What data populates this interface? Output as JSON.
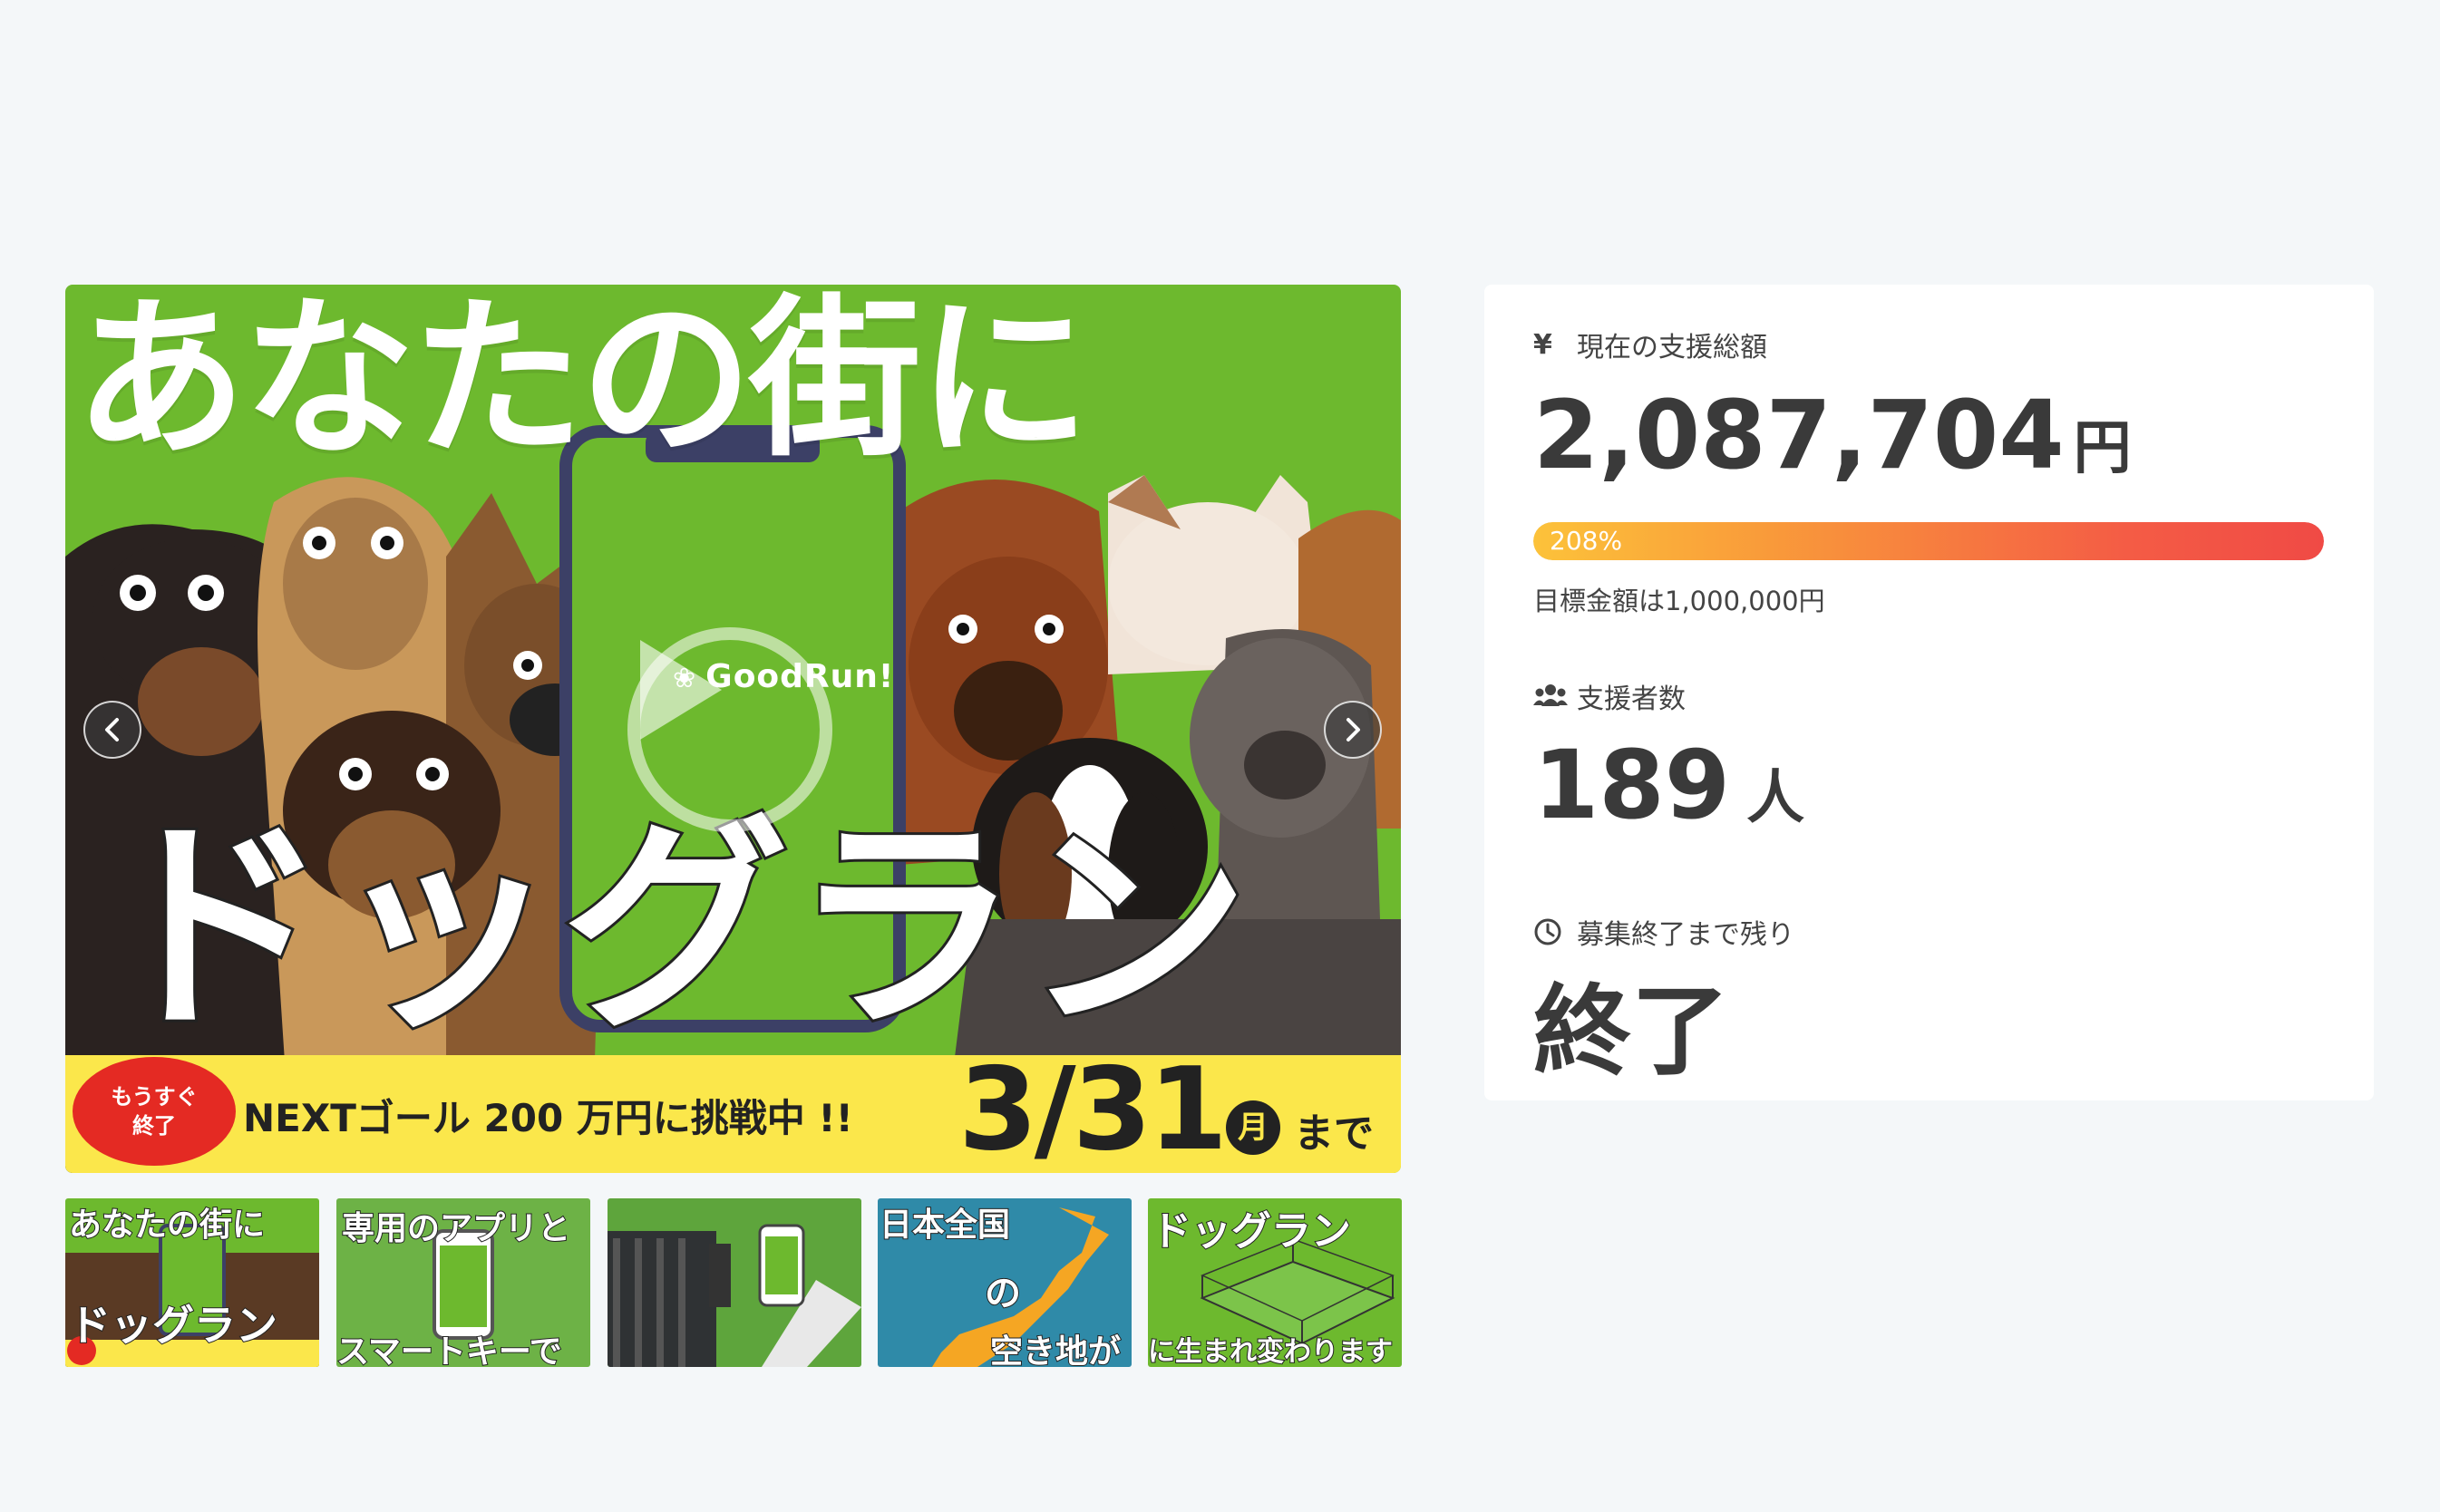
{
  "hero": {
    "title": "あなたの街に",
    "big_text": "ドッグラン",
    "phone_logo": "GoodRun!",
    "badge_line1": "もうすぐ",
    "badge_line2": "終了",
    "banner_text": "NEXTゴール 200 万円に挑戦中 !!",
    "banner_date": "3/31",
    "banner_day": "月",
    "banner_suffix": "まで"
  },
  "thumbnails": [
    {
      "label_top": "あなたの街に",
      "label_bottom": "ドッグラン",
      "color": "#6db92e"
    },
    {
      "label_top": "専用のアプリと",
      "label_bottom": "スマートキーで",
      "color": "#6db246"
    },
    {
      "label_top": "",
      "label_bottom": "",
      "color": "#5ea53c"
    },
    {
      "label_top": "日本全国",
      "label_mid": "の",
      "label_bottom": "空き地が",
      "color": "#2f8aa8"
    },
    {
      "label_top": "ドッグラン",
      "label_bottom": "に生まれ変わります",
      "color": "#6db92e"
    }
  ],
  "stats": {
    "total_label": "現在の支援総額",
    "total_value": "2,087,704",
    "total_unit": "円",
    "progress_text": "208%",
    "progress_percent": 208,
    "goal_text": "目標金額は1,000,000円",
    "supporters_label": "支援者数",
    "supporters_value": "189",
    "supporters_unit": "人",
    "remaining_label": "募集終了まで残り",
    "remaining_value": "終了"
  },
  "colors": {
    "hero_green": "#6db92e",
    "banner_yellow": "#fbe74b",
    "badge_red": "#e42a23",
    "progress_start": "#fcc23a",
    "progress_end": "#f04a45"
  },
  "icons": [
    "chevron-left-icon",
    "chevron-right-icon",
    "play-icon",
    "yen-icon",
    "users-icon",
    "clock-icon",
    "paw-icon"
  ]
}
